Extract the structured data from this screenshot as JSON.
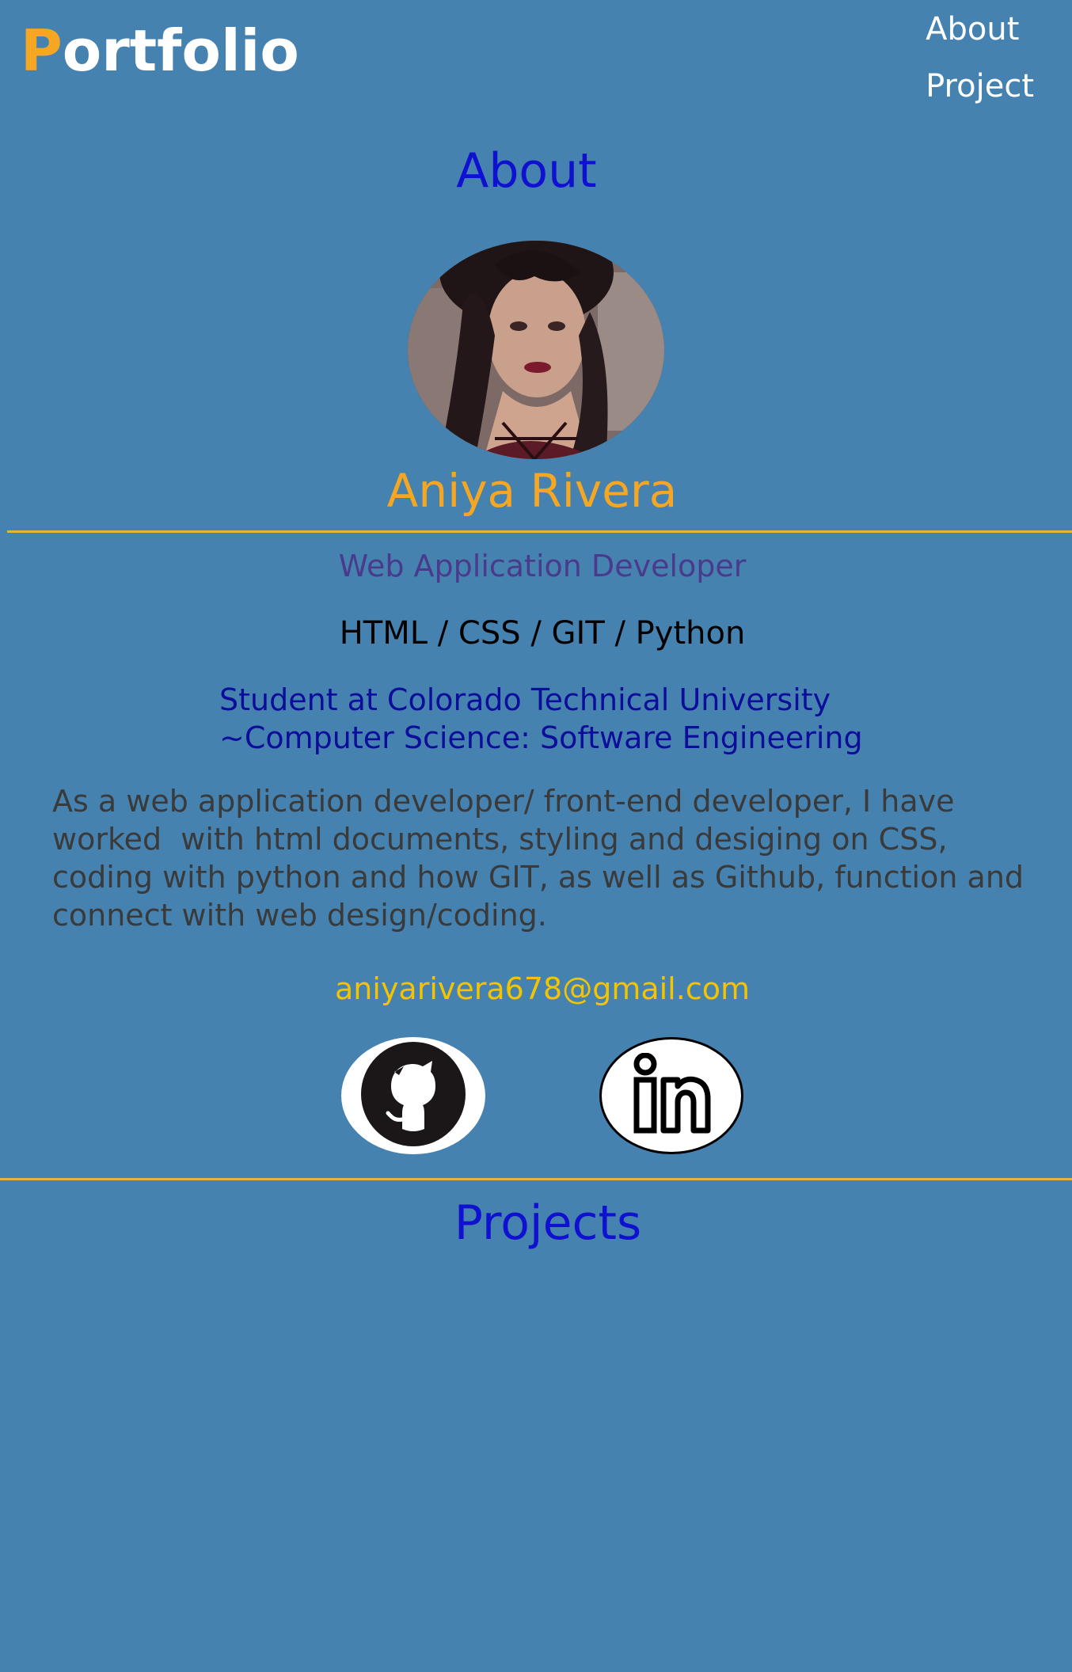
{
  "header": {
    "logo_initial": "P",
    "logo_rest": "ortfolio",
    "nav": [
      {
        "label": "About"
      },
      {
        "label": "Project"
      }
    ]
  },
  "about": {
    "title": "About",
    "name": "Aniya Rivera",
    "role": "Web Application Developer",
    "skills": "HTML / CSS / GIT / Python",
    "school_line1": "Student at Colorado Technical University",
    "school_line2": "~Computer Science: Software Engineering",
    "bio": "As a web application developer/ front-end developer, I have\nworked  with html documents, styling and desiging on CSS,\ncoding with python and how GIT, as well as Github, function and\nconnect with web design/coding.",
    "email": "aniyarivera678@gmail.com",
    "social": [
      {
        "icon": "github-icon"
      },
      {
        "icon": "linkedin-icon"
      }
    ]
  },
  "projects": {
    "title": "Projects"
  },
  "colors": {
    "background": "#4682b0",
    "accent": "#f5a623",
    "heading": "#1010d0",
    "divider": "#e3b43a",
    "email": "#f4c400"
  }
}
